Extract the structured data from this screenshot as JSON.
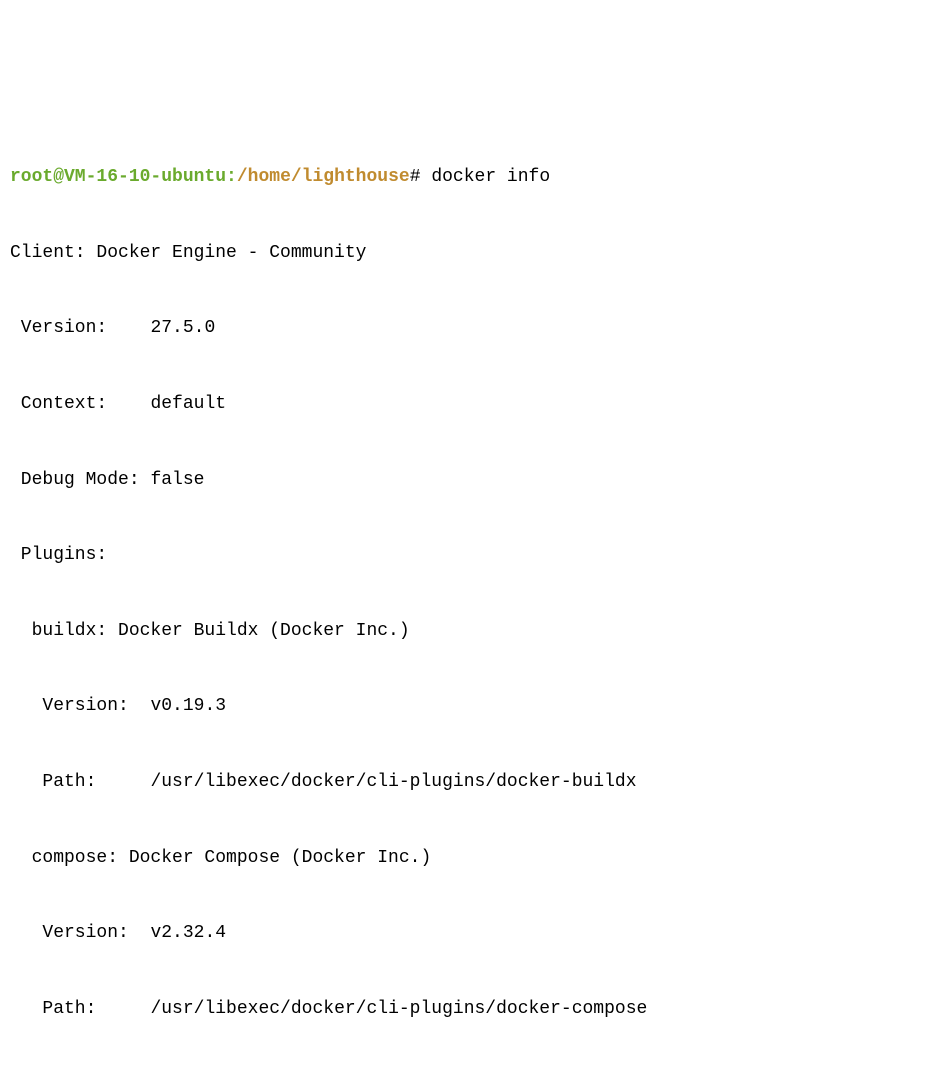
{
  "prompt": {
    "user_host": "root@VM-16-10-ubuntu",
    "colon": ":",
    "path": "/home/lighthouse",
    "hash": "#",
    "command": "docker info"
  },
  "output": {
    "client_header": "Client: Docker Engine - Community",
    "version_label": " Version:",
    "version_value": "27.5.0",
    "context_label": " Context:",
    "context_value": "default",
    "debug_label": " Debug Mode:",
    "debug_value": "false",
    "plugins_label": " Plugins:",
    "buildx_header": "  buildx: Docker Buildx (Docker Inc.)",
    "buildx_version_label": "   Version:",
    "buildx_version_value": "v0.19.3",
    "buildx_path_label": "   Path:",
    "buildx_path_value": "/usr/libexec/docker/cli-plugins/docker-buildx",
    "compose_header": "  compose: Docker Compose (Docker Inc.)",
    "compose_version_label": "   Version:",
    "compose_version_value": "v2.32.4",
    "compose_path_label": "   Path:",
    "compose_path_value": "/usr/libexec/docker/cli-plugins/docker-compose"
  }
}
